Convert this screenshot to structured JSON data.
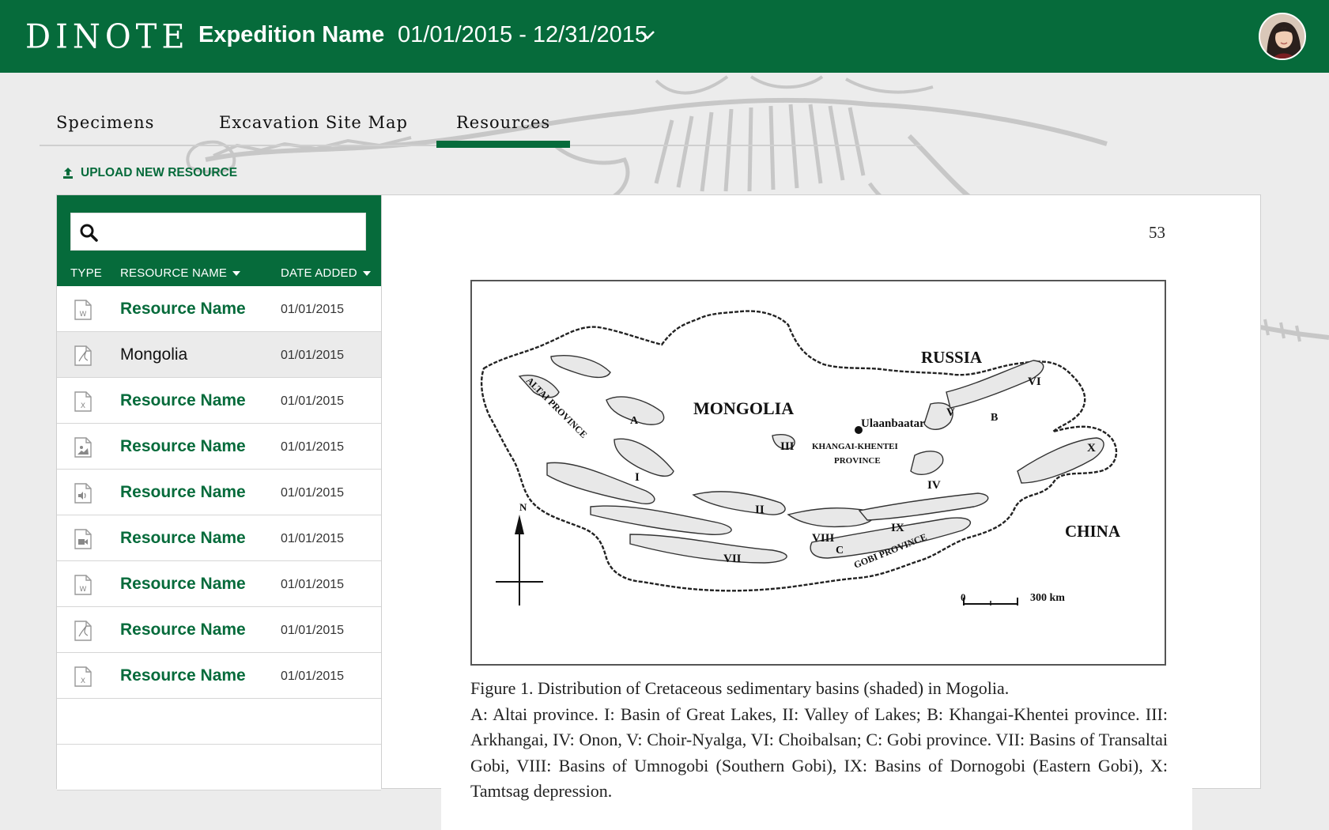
{
  "header": {
    "logo": "DINOTE",
    "expedition_name": "Expedition Name",
    "date_range": "01/01/2015 - 12/31/2015"
  },
  "tabs": [
    {
      "label": "Specimens",
      "active": false
    },
    {
      "label": "Excavation Site Map",
      "active": false
    },
    {
      "label": "Resources",
      "active": true
    }
  ],
  "upload_label": "UPLOAD NEW RESOURCE",
  "table": {
    "search_placeholder": "",
    "columns": {
      "type": "TYPE",
      "name": "RESOURCE NAME",
      "date": "DATE ADDED"
    },
    "rows": [
      {
        "type_icon": "word-file-icon",
        "name": "Resource Name",
        "date": "01/01/2015",
        "selected": false
      },
      {
        "type_icon": "pdf-file-icon",
        "name": "Mongolia",
        "date": "01/01/2015",
        "selected": true
      },
      {
        "type_icon": "excel-file-icon",
        "name": "Resource Name",
        "date": "01/01/2015",
        "selected": false
      },
      {
        "type_icon": "image-file-icon",
        "name": "Resource Name",
        "date": "01/01/2015",
        "selected": false
      },
      {
        "type_icon": "audio-file-icon",
        "name": "Resource Name",
        "date": "01/01/2015",
        "selected": false
      },
      {
        "type_icon": "video-file-icon",
        "name": "Resource Name",
        "date": "01/01/2015",
        "selected": false
      },
      {
        "type_icon": "word-file-icon",
        "name": "Resource Name",
        "date": "01/01/2015",
        "selected": false
      },
      {
        "type_icon": "pdf-file-icon",
        "name": "Resource Name",
        "date": "01/01/2015",
        "selected": false
      },
      {
        "type_icon": "excel-file-icon",
        "name": "Resource Name",
        "date": "01/01/2015",
        "selected": false
      }
    ]
  },
  "document": {
    "page_number": "53",
    "map_labels": {
      "russia": "RUSSIA",
      "mongolia": "MONGOLIA",
      "china": "CHINA",
      "capital": "Ulaanbaatar",
      "altai": "ALTAI PROVINCE",
      "khangai1": "KHANGAI-KHENTEI",
      "khangai2": "PROVINCE",
      "gobi": "GOBI PROVINCE",
      "north": "N",
      "scale_zero": "0",
      "scale_km": "300 km",
      "a": "A",
      "b": "B",
      "c": "C",
      "r1": "I",
      "r2": "II",
      "r3": "III",
      "r4": "IV",
      "r5": "V",
      "r6": "VI",
      "r7": "VII",
      "r8": "VIII",
      "r9": "IX",
      "r10": "X"
    },
    "caption_title": "Figure 1. Distribution of Cretaceous sedimentary basins (shaded) in Mogolia.",
    "caption_body": "A: Altai province. I: Basin of Great Lakes, II: Valley of Lakes; B: Khangai-Khentei province. III: Arkhangai, IV: Onon, V: Choir-Nyalga, VI: Choibalsan; C: Gobi province. VII: Basins of Transaltai Gobi, VIII: Basins of Umnogobi (Southern Gobi), IX: Basins of Dornogobi (Eastern Gobi), X: Tamtsag depression."
  },
  "colors": {
    "brand_green": "#066b3b",
    "selected_row": "#ebebeb"
  }
}
